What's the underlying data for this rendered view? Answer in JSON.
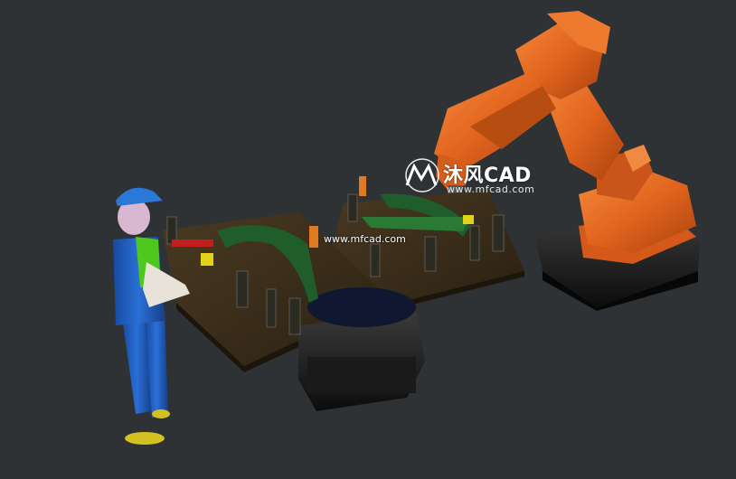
{
  "scene": {
    "background": "#2f3234",
    "robot_color": "#e2641e",
    "worker_overalls_color": "#1f5fc4",
    "worker_shirt_color": "#4fc81e",
    "worker_cap_color": "#2a78d8",
    "fixture_plate_color": "#3a2d1a",
    "part_color": "#1f5e2a",
    "base_color": "#121212"
  },
  "watermark": {
    "brand": "沐风CAD",
    "site_top": "www.mfcad.com",
    "site_center": "www.mfcad.com",
    "icon": "mf-logo-icon"
  }
}
